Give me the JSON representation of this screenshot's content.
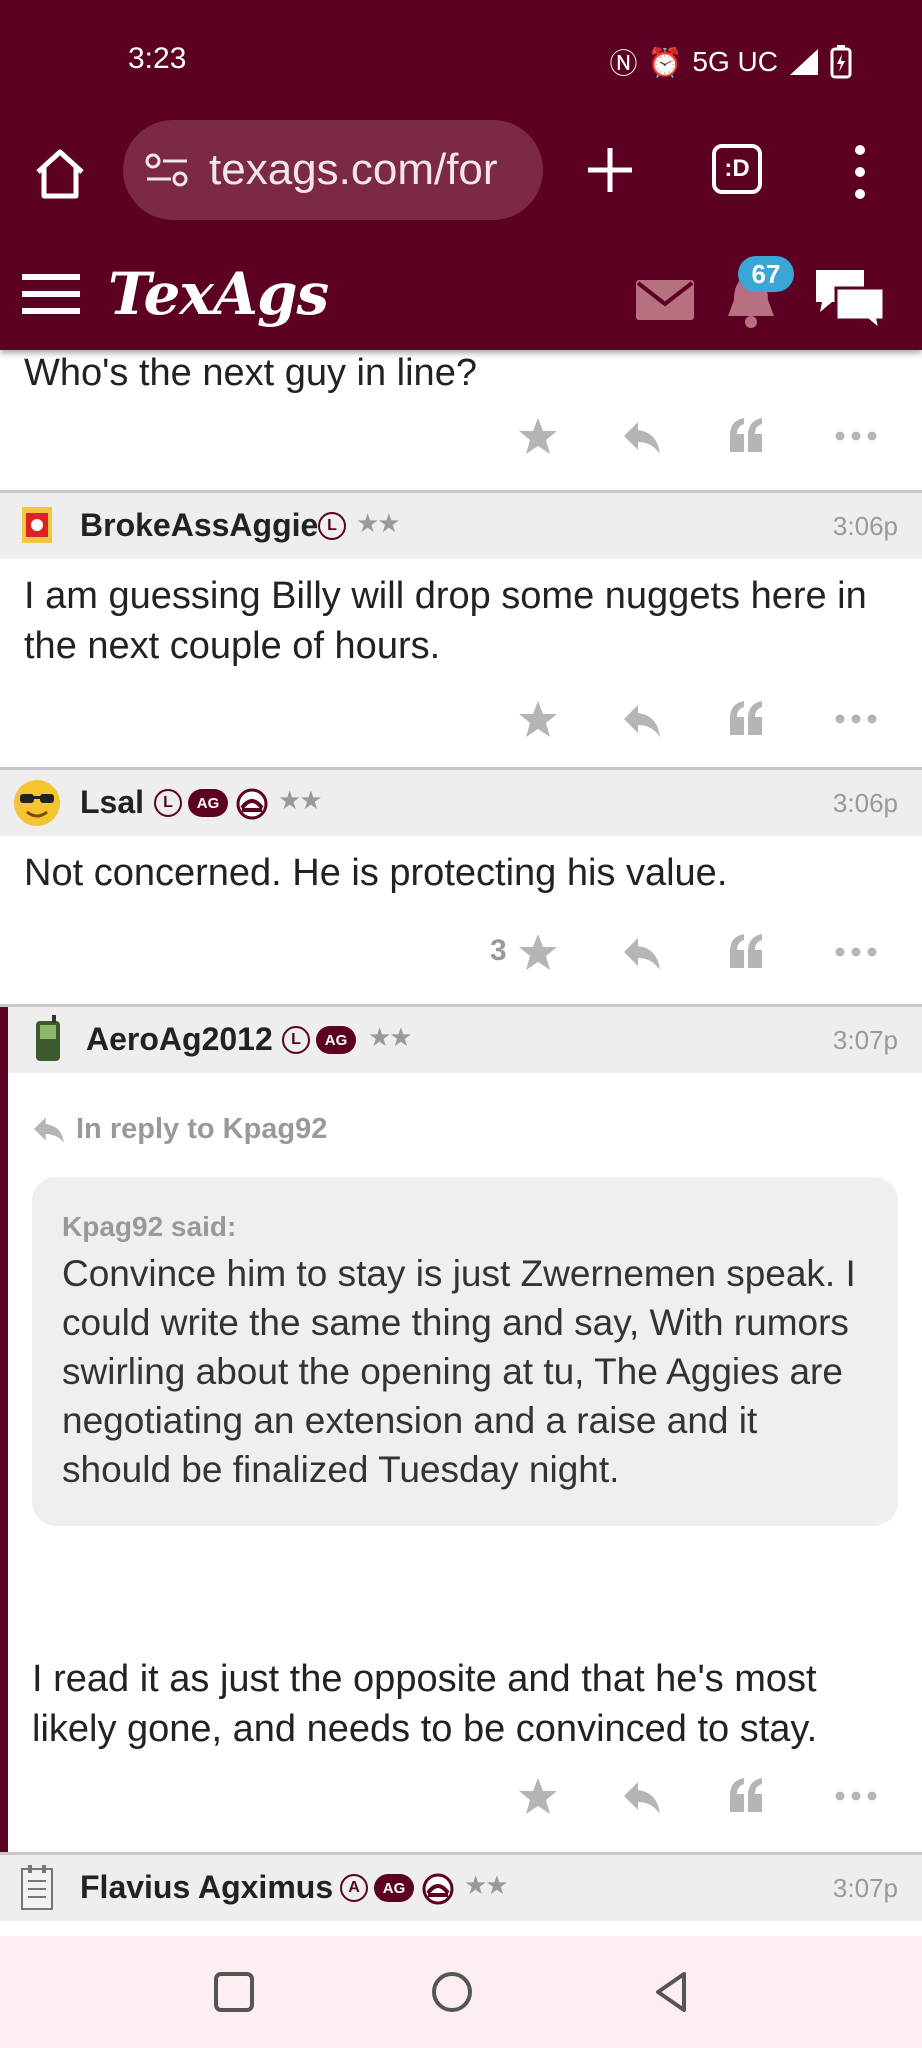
{
  "status": {
    "time": "3:23",
    "network": "5G UC"
  },
  "browser": {
    "url": "texags.com/for",
    "tabs_label": ":D"
  },
  "site": {
    "logo": "TexAgs",
    "notification_count": "67"
  },
  "prev_post": {
    "text": "Who's the next guy in line?"
  },
  "posts": [
    {
      "username": "BrokeAssAggie",
      "badges": [
        "L"
      ],
      "stars": "★★",
      "time": "3:06p",
      "text": "I am guessing Billy will drop some nuggets here in the next couple of hours.",
      "likes": ""
    },
    {
      "username": "Lsal",
      "badges": [
        "L",
        "AG"
      ],
      "stars": "★★",
      "time": "3:06p",
      "text": "Not concerned. He is protecting his value.",
      "likes": "3"
    },
    {
      "username": "AeroAg2012",
      "badges": [
        "L",
        "AG"
      ],
      "stars": "★★",
      "time": "3:07p",
      "in_reply_to": "In reply to Kpag92",
      "quote_author": "Kpag92 said:",
      "quote_text": "Convince him to stay is just Zwernemen speak. I could write the same thing and say, With rumors swirling about the opening at tu, The Aggies are negotiating an extension and a raise and it should be finalized Tuesday night.",
      "text": "I read it as just the opposite and that he's most likely gone, and needs to be convinced to stay."
    },
    {
      "username": "Flavius Agximus",
      "badges": [
        "A",
        "AG"
      ],
      "stars": "★★",
      "time": "3:07p"
    }
  ],
  "colors": {
    "maroon": "#5c0024",
    "badge_blue": "#3aa6d6",
    "icon_gray": "#b5b5b5"
  }
}
